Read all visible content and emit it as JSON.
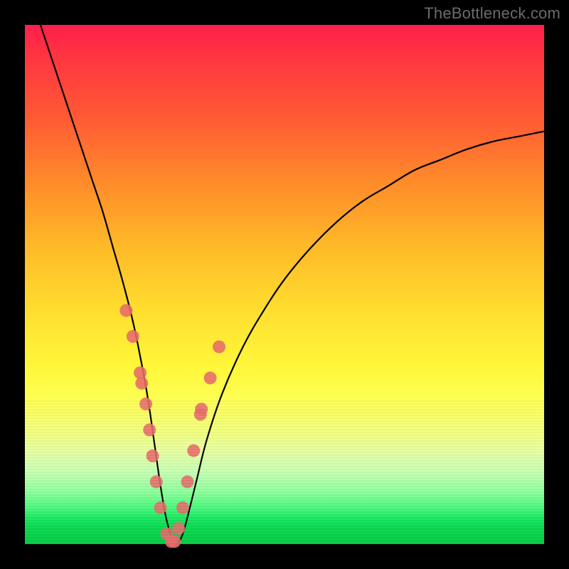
{
  "watermark": "TheBottleneck.com",
  "chart_data": {
    "type": "line",
    "title": "",
    "xlabel": "",
    "ylabel": "",
    "xlim": [
      0,
      100
    ],
    "ylim": [
      0,
      100
    ],
    "grid": false,
    "series": [
      {
        "name": "bottleneck-curve",
        "color": "#000000",
        "x": [
          3,
          5,
          7,
          9,
          11,
          13,
          15,
          17,
          19,
          21,
          23,
          24,
          25,
          26,
          27,
          28,
          29,
          30,
          31,
          33,
          35,
          38,
          42,
          46,
          50,
          55,
          60,
          65,
          70,
          75,
          80,
          85,
          90,
          95,
          100
        ],
        "y": [
          100,
          94,
          88,
          82,
          76,
          70,
          64,
          57,
          50,
          42,
          32,
          26,
          19,
          12,
          6,
          2,
          0,
          1,
          4,
          12,
          20,
          29,
          38,
          45,
          51,
          57,
          62,
          66,
          69,
          72,
          74,
          76,
          77.5,
          78.5,
          79.5
        ]
      }
    ],
    "markers": {
      "name": "sample-points",
      "color": "#e76a6a",
      "radius_px": 9,
      "x": [
        19.5,
        20.8,
        22.2,
        22.5,
        23.3,
        24.0,
        24.6,
        25.3,
        26.1,
        27.3,
        28.2,
        28.8,
        29.6,
        30.4,
        31.3,
        32.5,
        33.8,
        34.0,
        35.7,
        37.4
      ],
      "y": [
        45,
        40,
        33,
        31,
        27,
        22,
        17,
        12,
        7,
        2,
        0.5,
        0.5,
        3,
        7,
        12,
        18,
        25,
        26,
        32,
        38
      ]
    }
  }
}
